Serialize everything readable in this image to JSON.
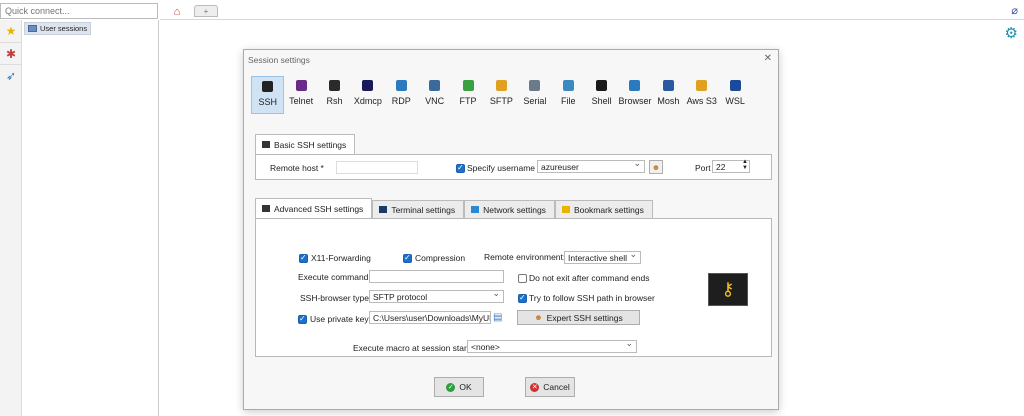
{
  "quick_connect": {
    "placeholder": "Quick connect..."
  },
  "sidebar": {
    "user_sessions_label": "User sessions"
  },
  "tabs_bar": {
    "new_tab_symbol": "+"
  },
  "dialog": {
    "title": "Session settings",
    "close_symbol": "✕",
    "protocols": [
      {
        "label": "SSH",
        "color": "#222222",
        "active": true
      },
      {
        "label": "Telnet",
        "color": "#6a2a8a"
      },
      {
        "label": "Rsh",
        "color": "#2a2a2a"
      },
      {
        "label": "Xdmcp",
        "color": "#1a1a5a"
      },
      {
        "label": "RDP",
        "color": "#2a7ac0"
      },
      {
        "label": "VNC",
        "color": "#3a6a9a"
      },
      {
        "label": "FTP",
        "color": "#3aa040"
      },
      {
        "label": "SFTP",
        "color": "#e0a020"
      },
      {
        "label": "Serial",
        "color": "#6a7a8a"
      },
      {
        "label": "File",
        "color": "#3a8ac0"
      },
      {
        "label": "Shell",
        "color": "#1a1a1a"
      },
      {
        "label": "Browser",
        "color": "#2a7ac0"
      },
      {
        "label": "Mosh",
        "color": "#2a5aa0"
      },
      {
        "label": "Aws S3",
        "color": "#e0a020"
      },
      {
        "label": "WSL",
        "color": "#1a4a9a"
      }
    ],
    "basic": {
      "tab_label": "Basic SSH settings",
      "remote_host_label": "Remote host *",
      "remote_host_value": "",
      "specify_username_label": "Specify username",
      "specify_username_checked": true,
      "username_value": "azureuser",
      "port_label": "Port",
      "port_value": "22"
    },
    "advanced_tabs": [
      {
        "label": "Advanced SSH settings",
        "active": true
      },
      {
        "label": "Terminal settings"
      },
      {
        "label": "Network settings"
      },
      {
        "label": "Bookmark settings"
      }
    ],
    "advanced": {
      "x11_label": "X11-Forwarding",
      "compression_label": "Compression",
      "remote_env_label": "Remote environment:",
      "remote_env_value": "Interactive shell",
      "execute_command_label": "Execute command:",
      "execute_command_value": "",
      "do_not_exit_label": "Do not exit after command ends",
      "ssh_browser_label": "SSH-browser type:",
      "ssh_browser_value": "SFTP protocol",
      "follow_ssh_label": "Try to follow SSH path in browser",
      "use_private_key_label": "Use private key",
      "private_key_value": "C:\\Users\\user\\Downloads\\MyUbur",
      "expert_button_label": "Expert SSH settings",
      "macro_label": "Execute macro at session start:",
      "macro_value": "<none>"
    },
    "ok_label": "OK",
    "cancel_label": "Cancel"
  }
}
